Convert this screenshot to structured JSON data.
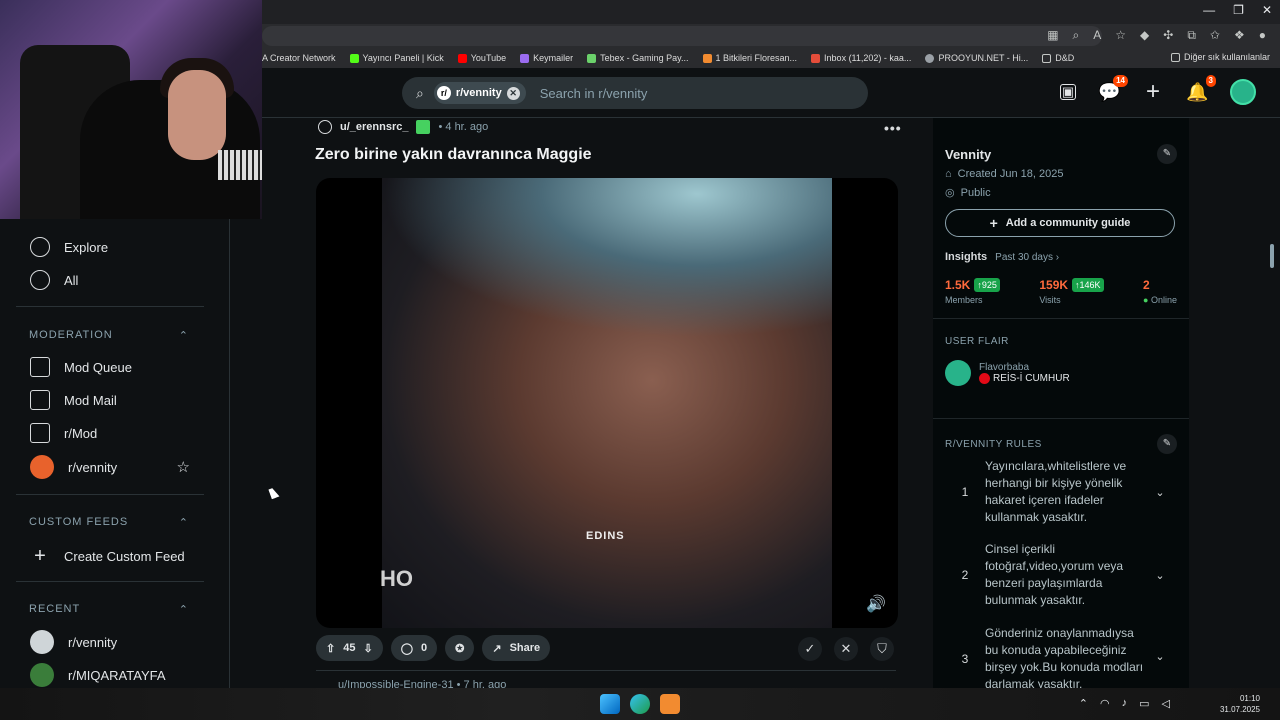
{
  "browser": {
    "window_controls": [
      "—",
      "❐",
      "✕"
    ],
    "bookmarks": [
      {
        "label": "A Creator Network",
        "color": "#ffffff"
      },
      {
        "label": "Yayıncı Paneli | Kick",
        "color": "#53fc18"
      },
      {
        "label": "YouTube",
        "color": "#ff0000"
      },
      {
        "label": "Keymailer",
        "color": "#9b6cf0"
      },
      {
        "label": "Tebex - Gaming Pay...",
        "color": "#6bd16b"
      },
      {
        "label": "1 Bitkileri Floresan...",
        "color": "#f28b30"
      },
      {
        "label": "Inbox (11,202) - kaa...",
        "color": "#e44d3a"
      },
      {
        "label": "PROOYUN.NET - Hi...",
        "color": "#9aa0a6"
      },
      {
        "label": "D&D",
        "color": "#c4c7c5"
      }
    ],
    "other_bookmarks": "Diğer sık kullanılanlar"
  },
  "header": {
    "chip_label": "r/vennity",
    "search_placeholder": "Search in r/vennity",
    "chat_badge": "14",
    "notif_badge": "3"
  },
  "sidebar": {
    "items": [
      {
        "label": "Explore"
      },
      {
        "label": "All"
      }
    ],
    "moderation_title": "MODERATION",
    "moderation": [
      {
        "label": "Mod Queue"
      },
      {
        "label": "Mod Mail"
      },
      {
        "label": "r/Mod"
      },
      {
        "label": "r/vennity"
      }
    ],
    "custom_feeds_title": "CUSTOM FEEDS",
    "create_custom_feed": "Create Custom Feed",
    "recent_title": "RECENT",
    "recent": [
      {
        "label": "r/vennity"
      },
      {
        "label": "r/MIQARATAYFA"
      }
    ]
  },
  "post": {
    "author": "u/_erennsrc_",
    "time": "• 4 hr. ago",
    "title": "Zero birine yakın davranınca Maggie",
    "overlay_text": "EDINS",
    "overlay_text2": "HO",
    "upvotes": "45",
    "comments": "0",
    "share_label": "Share",
    "next_post_author": "u/Impossible-Engine-31",
    "next_post_time": "• 7 hr. ago"
  },
  "community": {
    "name": "Vennity",
    "created": "Created Jun 18, 2025",
    "visibility": "Public",
    "guide_button": "Add a community guide",
    "insights_label": "Insights",
    "insights_period": "Past 30 days ›",
    "members_value": "1.5K",
    "members_delta": "925",
    "members_label": "Members",
    "visits_value": "159K",
    "visits_delta": "146K",
    "visits_label": "Visits",
    "online_value": "2",
    "online_label": "Online",
    "flair_title": "USER FLAIR",
    "flair_user": "Flavorbaba",
    "flair_text": "REİS-İ CUMHUR",
    "rules_title": "R/VENNITY RULES",
    "rules": [
      {
        "num": "1",
        "text": "Yayıncılara,whitelistlere ve herhangi bir kişiye yönelik hakaret içeren ifadeler kullanmak yasaktır."
      },
      {
        "num": "2",
        "text": "Cinsel içerikli fotoğraf,video,yorum veya benzeri paylaşımlarda bulunmak yasaktır."
      },
      {
        "num": "3",
        "text": "Gönderiniz onaylanmadıysa bu konuda yapabileceğiniz birşey yok.Bu konuda modları darlamak yasaktır."
      }
    ]
  },
  "taskbar": {
    "time": "01:10",
    "date": "31.07.2025"
  },
  "colors": {
    "accent": "#ff4500",
    "stat_orange": "#ff6a3d",
    "stat_green": "#18a34a",
    "avatar": "#28b38a"
  }
}
